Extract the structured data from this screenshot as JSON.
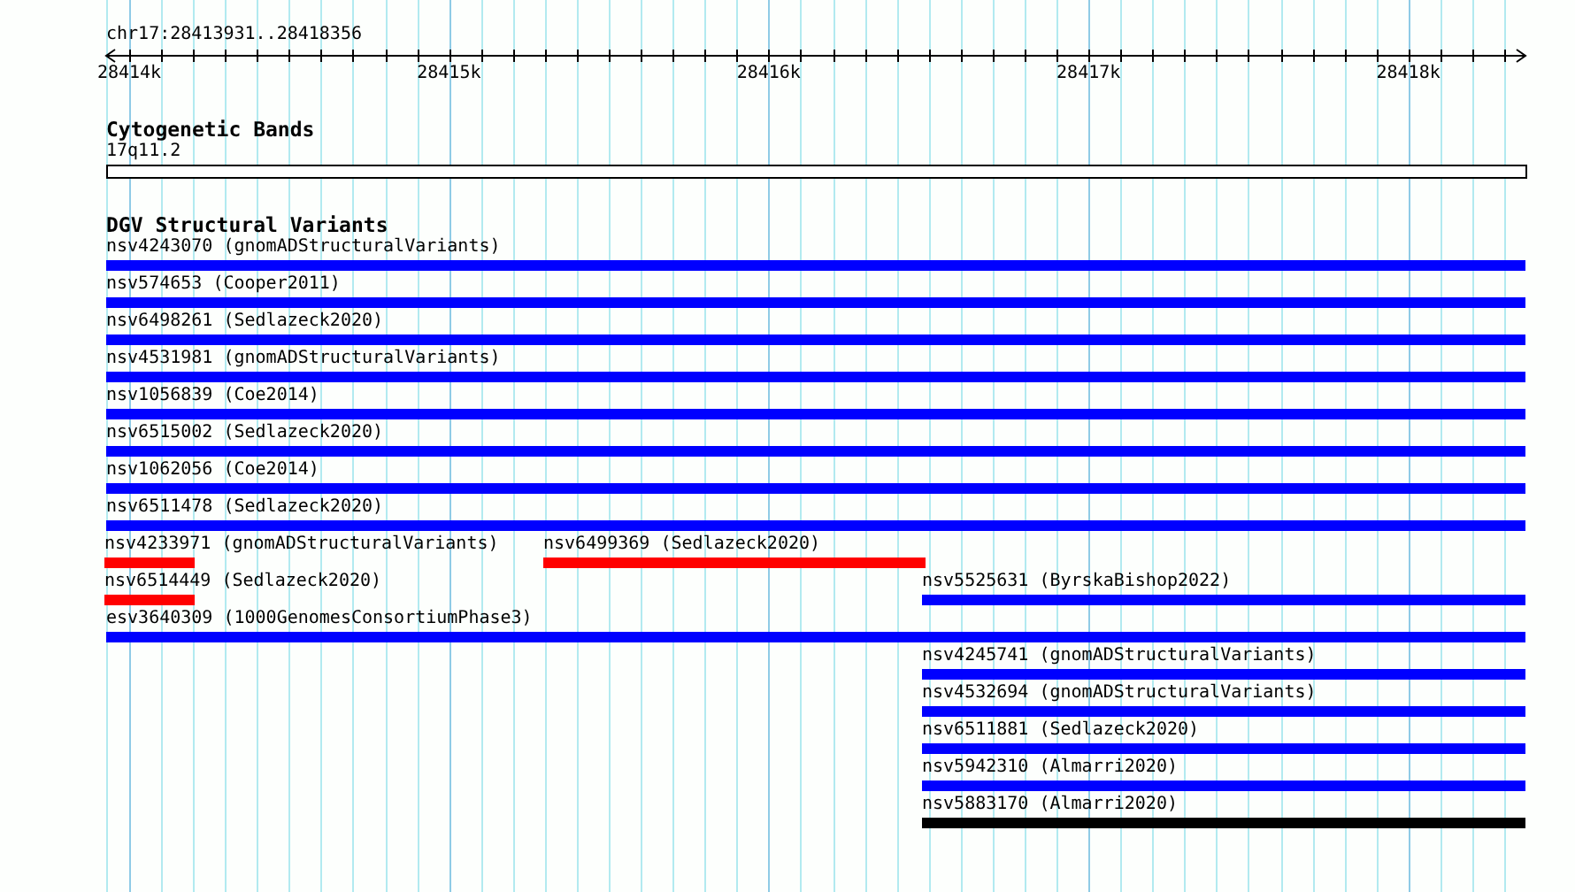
{
  "ruler": {
    "location": "chr17:28413931..28418356",
    "ticks": [
      "28414k",
      "28415k",
      "28416k",
      "28417k",
      "28418k"
    ]
  },
  "tracks": [
    {
      "kind": "bands",
      "title": "Cytogenetic Bands",
      "band": "17q11.2"
    },
    {
      "kind": "variants",
      "title": "DGV Structural Variants",
      "rows": [
        {
          "features": [
            {
              "label": "nsv4243070 (gnomADStructuralVariants)",
              "color": "#0000ff",
              "kind": "full"
            }
          ]
        },
        {
          "features": [
            {
              "label": "nsv574653 (Cooper2011)",
              "color": "#0000ff",
              "kind": "full"
            }
          ]
        },
        {
          "features": [
            {
              "label": "nsv6498261 (Sedlazeck2020)",
              "color": "#0000ff",
              "kind": "full"
            }
          ]
        },
        {
          "features": [
            {
              "label": "nsv4531981 (gnomADStructuralVariants)",
              "color": "#0000ff",
              "kind": "full"
            }
          ]
        },
        {
          "features": [
            {
              "label": "nsv1056839 (Coe2014)",
              "color": "#0000ff",
              "kind": "full"
            }
          ]
        },
        {
          "features": [
            {
              "label": "nsv6515002 (Sedlazeck2020)",
              "color": "#0000ff",
              "kind": "full"
            }
          ]
        },
        {
          "features": [
            {
              "label": "nsv1062056 (Coe2014)",
              "color": "#0000ff",
              "kind": "full"
            }
          ]
        },
        {
          "features": [
            {
              "label": "nsv6511478 (Sedlazeck2020)",
              "color": "#0000ff",
              "kind": "full"
            }
          ]
        },
        {
          "features": [
            {
              "label": "nsv4233971 (gnomADStructuralVariants)",
              "color": "#ff0000",
              "kind": "start"
            },
            {
              "label": "nsv6499369 (Sedlazeck2020)",
              "color": "#ff0000",
              "kind": "middle"
            }
          ]
        },
        {
          "features": [
            {
              "label": "nsv6514449 (Sedlazeck2020)",
              "color": "#ff0000",
              "kind": "start"
            },
            {
              "label": "nsv5525631 (ByrskaBishop2022)",
              "color": "#0000ff",
              "kind": "end"
            }
          ]
        },
        {
          "features": [
            {
              "label": "esv3640309 (1000GenomesConsortiumPhase3)",
              "color": "#0000ff",
              "kind": "full"
            }
          ]
        },
        {
          "features": [
            {
              "label": "nsv4245741 (gnomADStructuralVariants)",
              "color": "#0000ff",
              "kind": "end"
            }
          ]
        },
        {
          "features": [
            {
              "label": "nsv4532694 (gnomADStructuralVariants)",
              "color": "#0000ff",
              "kind": "end"
            }
          ]
        },
        {
          "features": [
            {
              "label": "nsv6511881 (Sedlazeck2020)",
              "color": "#0000ff",
              "kind": "end"
            }
          ]
        },
        {
          "features": [
            {
              "label": "nsv5942310 (Almarri2020)",
              "color": "#0000ff",
              "kind": "end"
            }
          ]
        },
        {
          "features": [
            {
              "label": "nsv5883170 (Almarri2020)",
              "color": "#000000",
              "kind": "end"
            }
          ]
        }
      ]
    }
  ]
}
